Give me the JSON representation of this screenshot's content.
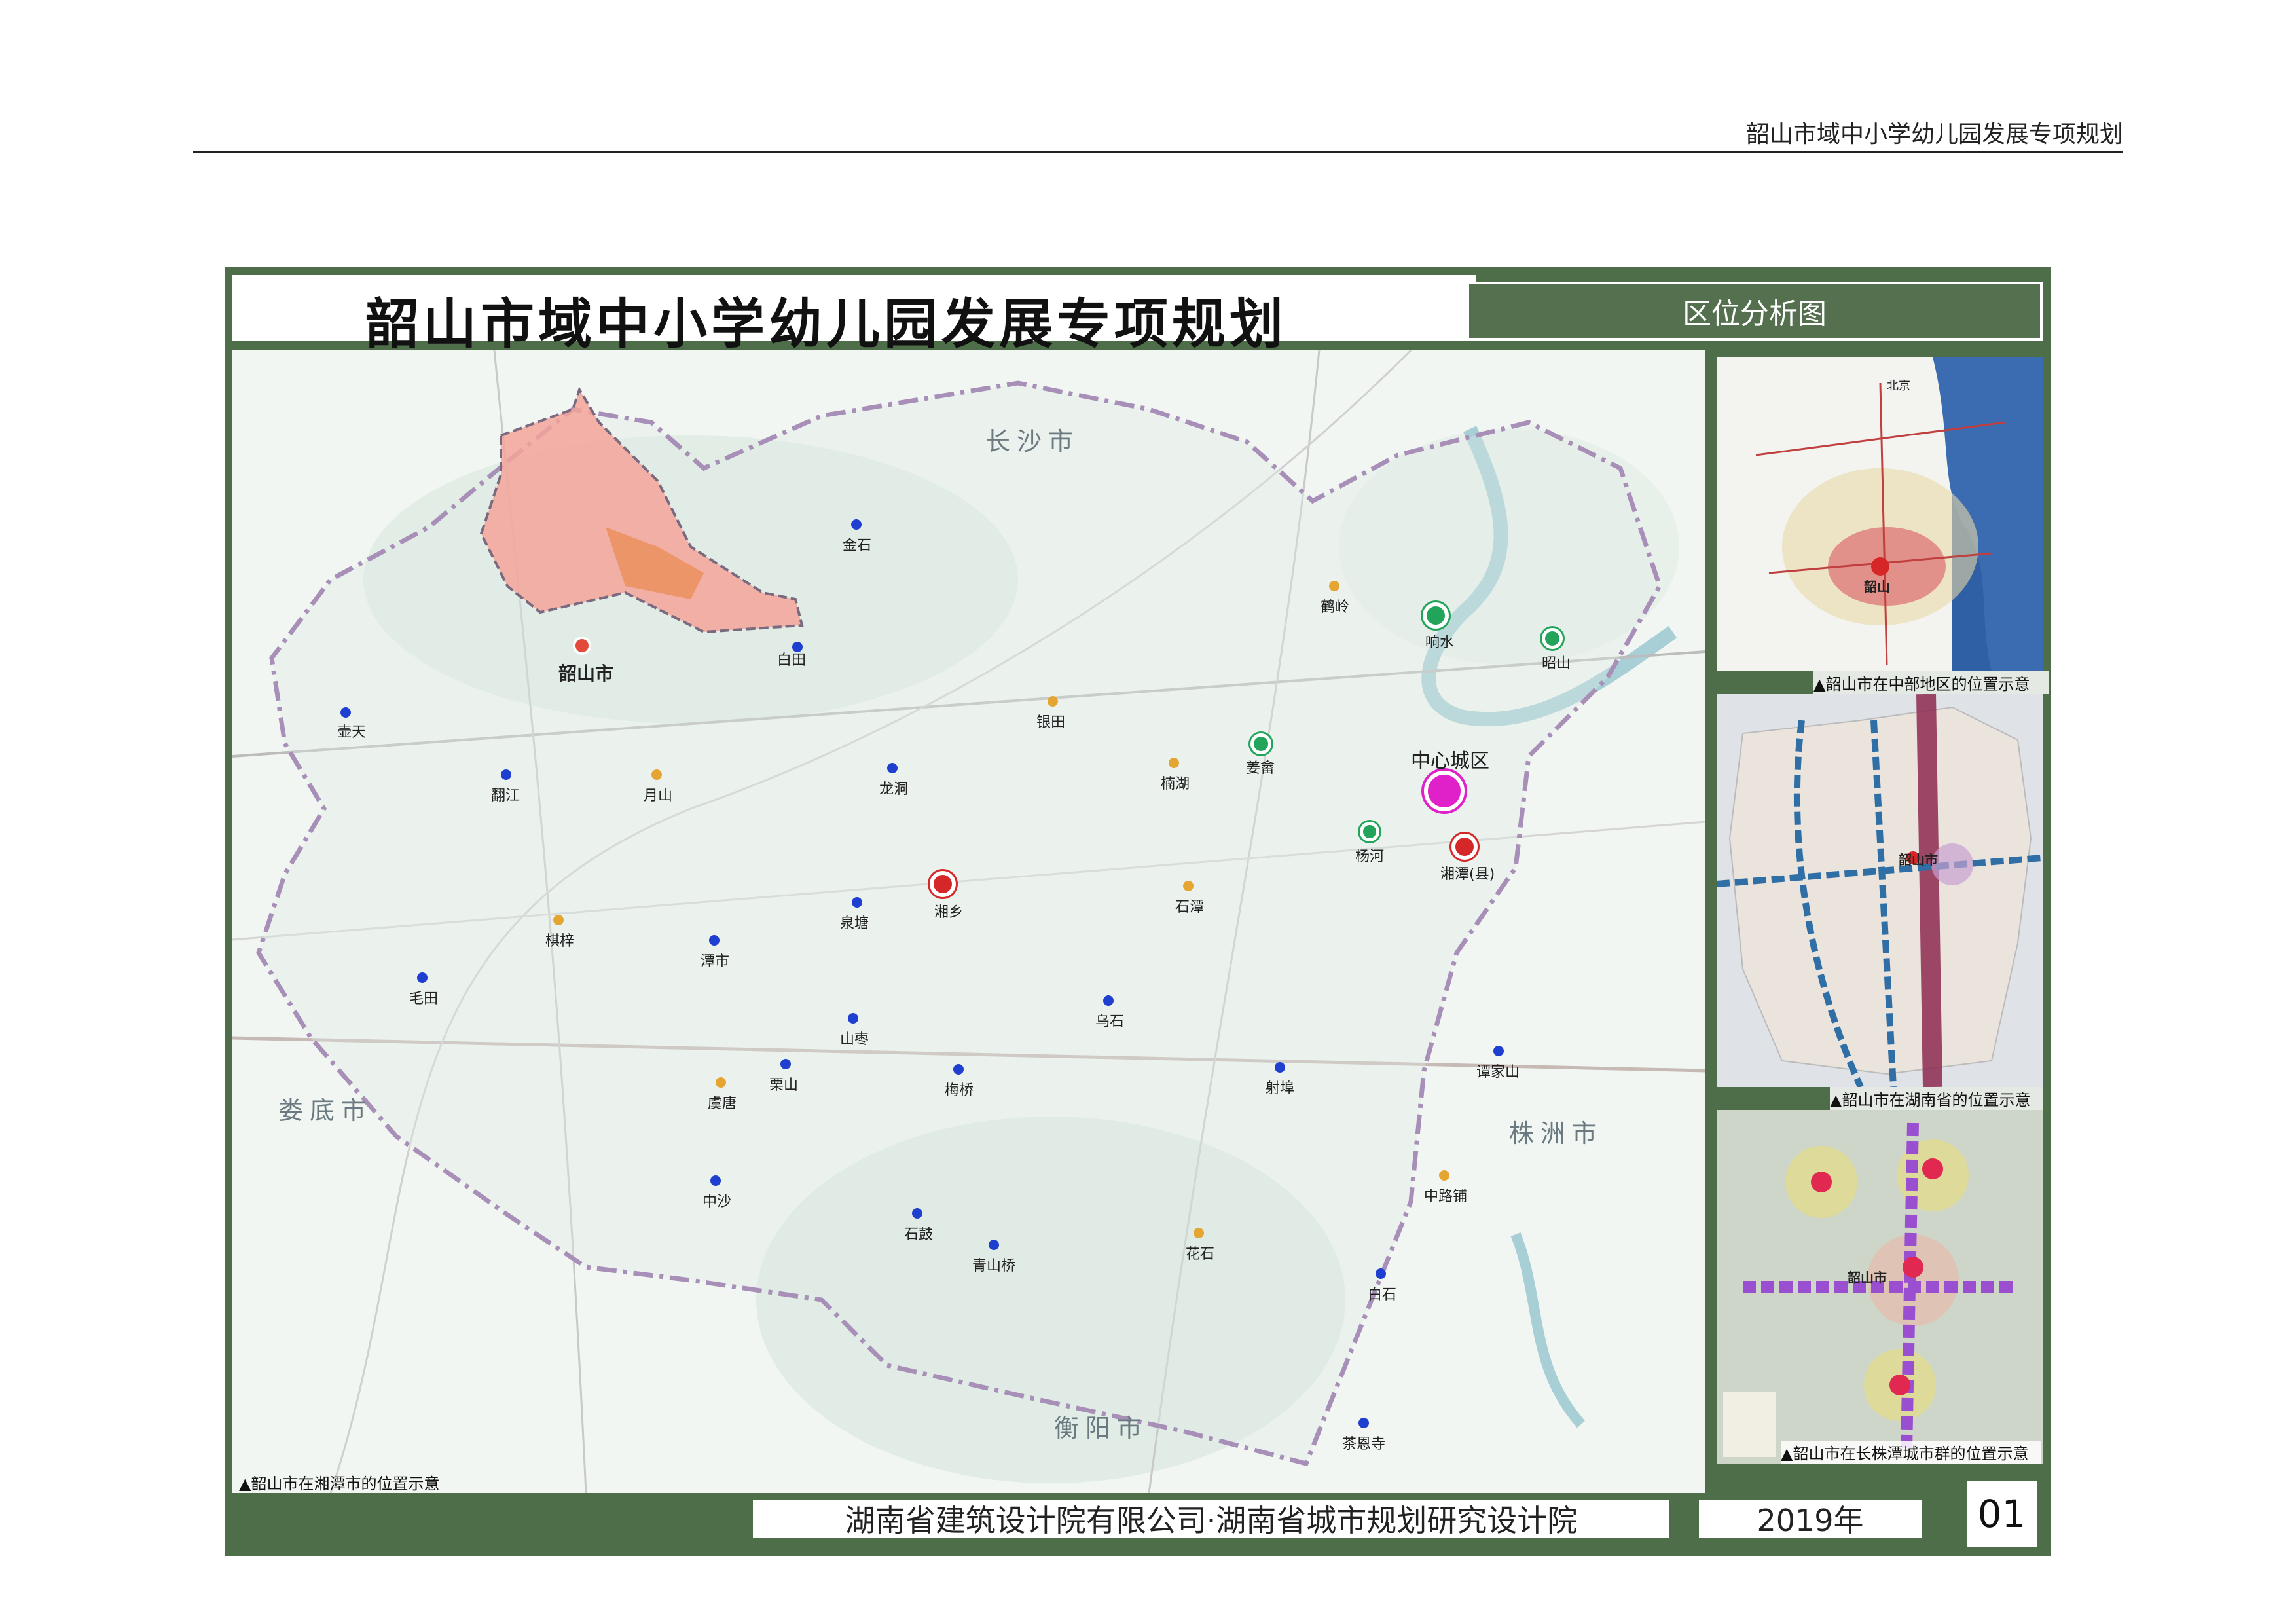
{
  "document": {
    "header": "韶山市域中小学幼儿园发展专项规划"
  },
  "board": {
    "title": "韶山市域中小学幼儿园发展专项规划",
    "subtitle": "区位分析图",
    "company": "湖南省建筑设计院有限公司·湖南省城市规划研究设计院",
    "year": "2019年",
    "page": "01"
  },
  "main_map": {
    "caption": "▲韶山市在湘潭市的位置示意",
    "cities": {
      "changsha": "长沙市",
      "loudi": "娄底市",
      "zhuzhou": "株洲市",
      "hengyang": "衡阳市"
    },
    "highlight": {
      "shaoshan": "韶山市",
      "center": "中心城区"
    },
    "county_labels": {
      "xiangxiang": "湘乡",
      "xiangtan_county": "湘潭(县)"
    },
    "towns_blue": [
      "壶天",
      "翻江",
      "毛田",
      "潭市",
      "泉塘",
      "龙洞",
      "白田",
      "金石",
      "山枣",
      "栗山",
      "中沙",
      "石鼓",
      "青山桥",
      "乌石",
      "射埠",
      "谭家山",
      "白石",
      "茶恩寺",
      "梅桥"
    ],
    "towns_orange": [
      "月山",
      "棋梓",
      "虞唐",
      "花石",
      "中路铺",
      "石潭",
      "楠湖",
      "鹤岭",
      "银田"
    ],
    "towns_green": [
      "响水",
      "昭山",
      "姜畲",
      "杨河"
    ],
    "legend_colors": {
      "shaoshan_area": "#f4a59a",
      "blue_town": "#1e3fcf",
      "orange_town": "#e5a533",
      "green_town": "#22a45a",
      "red_town": "#d62728",
      "center": "#e020c8",
      "border": "#a88fb8",
      "frame": "#4e6e4a"
    }
  },
  "insets": [
    {
      "caption": "▲韶山市在中部地区的位置示意",
      "labels": [
        "北京",
        "韶山"
      ]
    },
    {
      "caption": "▲韶山市在湖南省的位置示意",
      "labels": [
        "韶山市"
      ]
    },
    {
      "caption": "▲韶山市在长株潭城市群的位置示意",
      "labels": [
        "韶山市"
      ]
    }
  ]
}
